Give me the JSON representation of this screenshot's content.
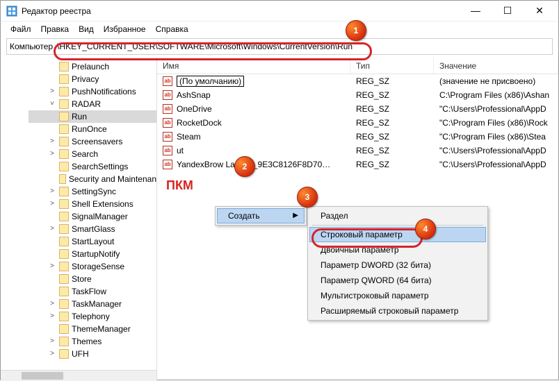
{
  "window": {
    "title": "Редактор реестра",
    "min": "—",
    "max": "☐",
    "close": "✕"
  },
  "menu": {
    "file": "Файл",
    "edit": "Правка",
    "view": "Вид",
    "fav": "Избранное",
    "help": "Справка"
  },
  "addr": {
    "label": "Компьютер",
    "path": "\\HKEY_CURRENT_USER\\SOFTWARE\\Microsoft\\Windows\\CurrentVersion\\Run"
  },
  "headers": {
    "name": "Имя",
    "type": "Тип",
    "value": "Значение"
  },
  "tree": [
    {
      "label": "Prelaunch"
    },
    {
      "label": "Privacy"
    },
    {
      "label": "PushNotifications",
      "chev": "˃"
    },
    {
      "label": "RADAR",
      "chev": "˅",
      "open": true
    },
    {
      "label": "Run",
      "selected": true
    },
    {
      "label": "RunOnce"
    },
    {
      "label": "Screensavers",
      "chev": "˃"
    },
    {
      "label": "Search",
      "chev": "˃"
    },
    {
      "label": "SearchSettings"
    },
    {
      "label": "Security and Maintenan"
    },
    {
      "label": "SettingSync",
      "chev": "˃"
    },
    {
      "label": "Shell Extensions",
      "chev": "˃"
    },
    {
      "label": "SignalManager"
    },
    {
      "label": "SmartGlass",
      "chev": "˃"
    },
    {
      "label": "StartLayout"
    },
    {
      "label": "StartupNotify"
    },
    {
      "label": "StorageSense",
      "chev": "˃"
    },
    {
      "label": "Store"
    },
    {
      "label": "TaskFlow"
    },
    {
      "label": "TaskManager",
      "chev": "˃"
    },
    {
      "label": "Telephony",
      "chev": "˃"
    },
    {
      "label": "ThemeManager"
    },
    {
      "label": "Themes",
      "chev": "˃"
    },
    {
      "label": "UFH",
      "chev": "˃"
    }
  ],
  "rows": [
    {
      "name": "(По умолчанию)",
      "type": "REG_SZ",
      "value": "(значение не присвоено)",
      "default": true
    },
    {
      "name": "AshSnap",
      "type": "REG_SZ",
      "value": "C:\\Program Files (x86)\\Ashan"
    },
    {
      "name": "OneDrive",
      "type": "REG_SZ",
      "value": "\"C:\\Users\\Professional\\AppD"
    },
    {
      "name": "RocketDock",
      "type": "REG_SZ",
      "value": "\"C:\\Program Files (x86)\\Rock"
    },
    {
      "name": "Steam",
      "type": "REG_SZ",
      "value": "\"C:\\Program Files (x86)\\Stea"
    },
    {
      "name": "ut",
      "type": "REG_SZ",
      "value": "\"C:\\Users\\Professional\\AppD"
    },
    {
      "name": "YandexBrow          Launch_9E3C8126F8D70…",
      "type": "REG_SZ",
      "value": "\"C:\\Users\\Professional\\AppD"
    }
  ],
  "ctx1": {
    "create": "Создать"
  },
  "ctx2": {
    "section": "Раздел",
    "string": "Строковый параметр",
    "binary": "Двоичный параметр",
    "dword": "Параметр DWORD (32 бита)",
    "qword": "Параметр QWORD (64 бита)",
    "multi": "Мультистроковый параметр",
    "expand": "Расширяемый строковый параметр"
  },
  "annot": {
    "pkm": "ПКМ",
    "b1": "1",
    "b2": "2",
    "b3": "3",
    "b4": "4"
  }
}
